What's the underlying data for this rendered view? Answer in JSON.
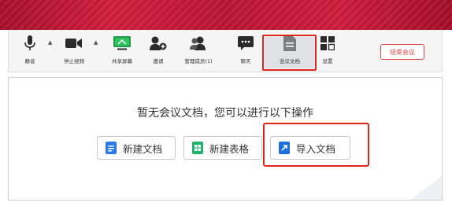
{
  "toolbar": {
    "mute": {
      "label": "静音",
      "icon": "microphone-icon"
    },
    "video": {
      "label": "停止视频",
      "icon": "video-camera-icon"
    },
    "share": {
      "label": "共享屏幕",
      "icon": "share-screen-icon"
    },
    "invite": {
      "label": "邀请",
      "icon": "add-user-icon"
    },
    "members": {
      "label": "管理成员(1)",
      "icon": "members-icon"
    },
    "chat": {
      "label": "聊天",
      "icon": "chat-icon"
    },
    "docs": {
      "label": "会议文档",
      "icon": "document-icon"
    },
    "settings": {
      "label": "设置",
      "icon": "grid-settings-icon"
    },
    "end_meeting": "结束会议"
  },
  "panel": {
    "empty_message": "暂无会议文档，您可以进行以下操作",
    "actions": [
      {
        "label": "新建文档",
        "icon": "doc-icon",
        "color": "#2a78e4"
      },
      {
        "label": "新建表格",
        "icon": "sheet-icon",
        "color": "#23b26d"
      },
      {
        "label": "导入文档",
        "icon": "import-icon",
        "color": "#1d6fe0"
      }
    ]
  },
  "colors": {
    "banner": "#c81a35",
    "highlight": "#e0261b",
    "end_button": "#e04545"
  }
}
